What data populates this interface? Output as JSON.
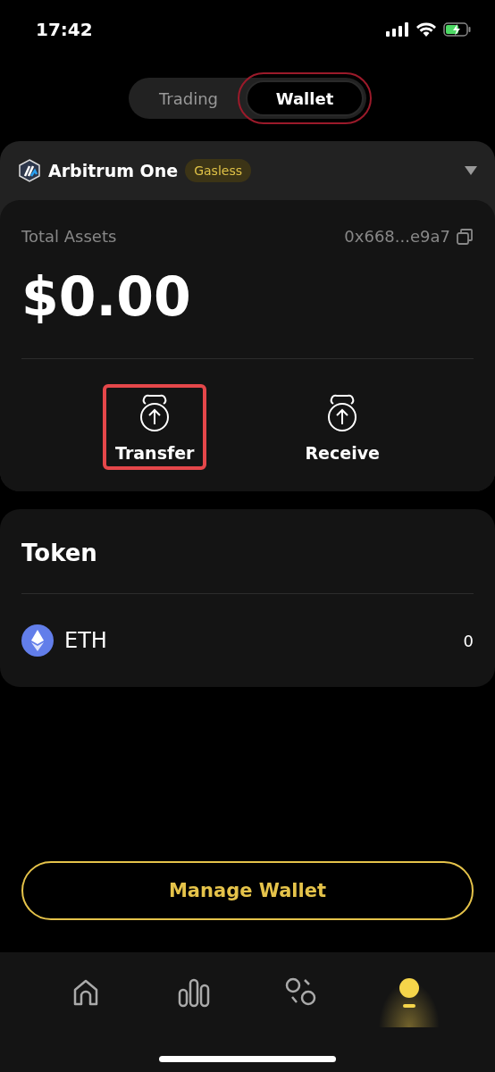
{
  "status_bar": {
    "time": "17:42"
  },
  "mode_tabs": [
    {
      "label": "Trading",
      "selected": false,
      "highlighted": false
    },
    {
      "label": "Wallet",
      "selected": true,
      "highlighted": true
    }
  ],
  "network": {
    "name": "Arbitrum One",
    "badge": "Gasless"
  },
  "assets": {
    "label": "Total Assets",
    "address": "0x668...e9a7",
    "total": "$0.00"
  },
  "actions": [
    {
      "label": "Transfer",
      "highlighted": true
    },
    {
      "label": "Receive",
      "highlighted": false
    }
  ],
  "tokens": {
    "title": "Token",
    "rows": [
      {
        "symbol": "ETH",
        "amount": "0"
      }
    ]
  },
  "manage_button": "Manage Wallet",
  "nav": [
    {
      "kind": "home",
      "selected": false
    },
    {
      "kind": "markets",
      "selected": false
    },
    {
      "kind": "swap",
      "selected": false
    },
    {
      "kind": "profile",
      "selected": true
    }
  ]
}
